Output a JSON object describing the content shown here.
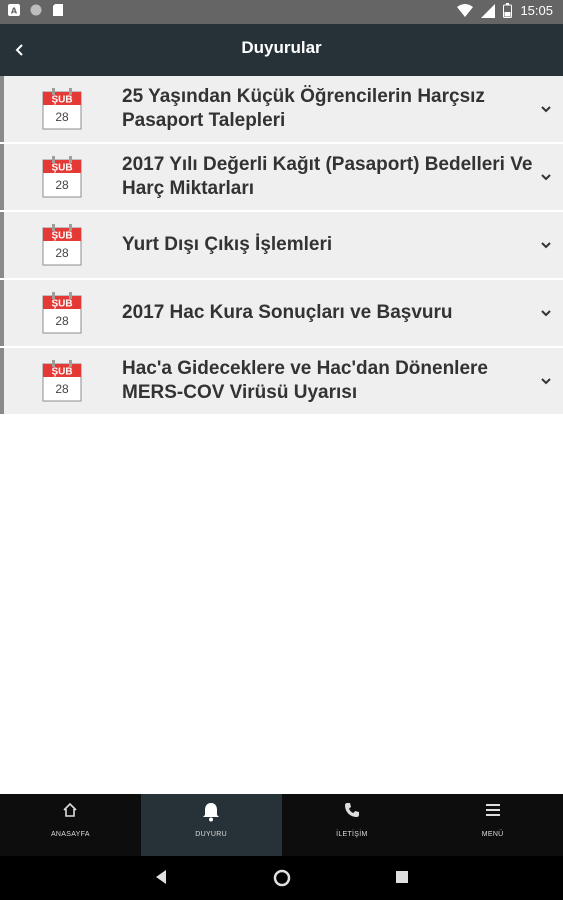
{
  "status_bar": {
    "time": "15:05"
  },
  "header": {
    "title": "Duyurular"
  },
  "calendar": {
    "month": "ŞUB",
    "day": "28"
  },
  "announcements": [
    {
      "title": "25 Yaşından Küçük Öğrencilerin Harçsız Pasaport Talepleri"
    },
    {
      "title": "2017 Yılı Değerli Kağıt (Pasaport) Bedelleri Ve Harç Miktarları"
    },
    {
      "title": "Yurt Dışı Çıkış İşlemleri"
    },
    {
      "title": "2017 Hac Kura Sonuçları ve Başvuru"
    },
    {
      "title": "Hac'a Gideceklere ve Hac'dan Dönenlere MERS-COV Virüsü Uyarısı"
    }
  ],
  "bottom_nav": [
    {
      "label": "ANASAYFA",
      "icon": "home-icon"
    },
    {
      "label": "DUYURU",
      "icon": "bell-icon",
      "active": true
    },
    {
      "label": "İLETİŞİM",
      "icon": "phone-icon"
    },
    {
      "label": "MENÜ",
      "icon": "menu-icon"
    }
  ],
  "colors": {
    "header_bg": "#263238",
    "status_bg": "#656565",
    "item_bg": "#efefef",
    "calendar_red": "#e53935"
  }
}
